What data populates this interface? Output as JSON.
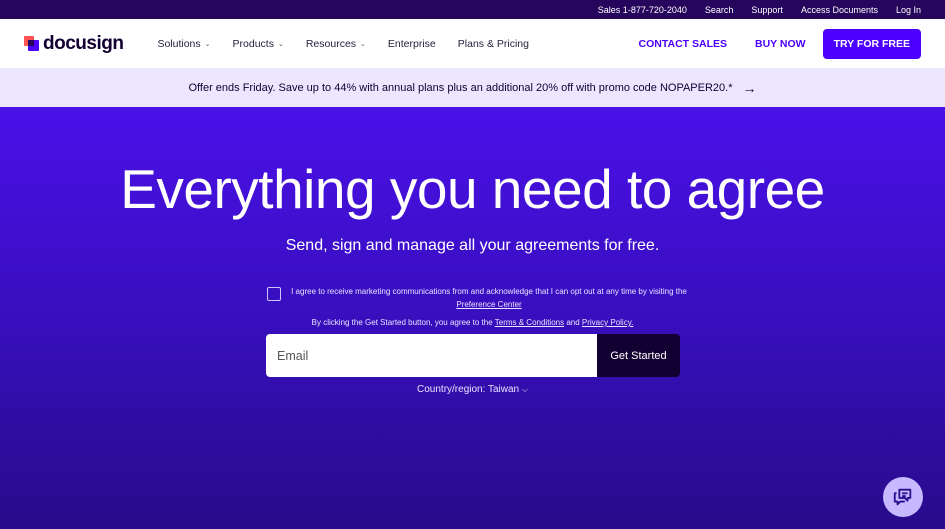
{
  "utility": {
    "sales": "Sales 1-877-720-2040",
    "search": "Search",
    "support": "Support",
    "access_documents": "Access Documents",
    "login": "Log In"
  },
  "nav": {
    "logo_text": "docusign",
    "links": [
      {
        "label": "Solutions",
        "dropdown": true
      },
      {
        "label": "Products",
        "dropdown": true
      },
      {
        "label": "Resources",
        "dropdown": true
      },
      {
        "label": "Enterprise",
        "dropdown": false
      },
      {
        "label": "Plans & Pricing",
        "dropdown": false
      }
    ],
    "contact_sales": "CONTACT SALES",
    "buy_now": "BUY NOW",
    "try_free": "TRY FOR FREE"
  },
  "promo": {
    "text": "Offer ends Friday. Save up to 44% with annual plans plus an additional 20% off with promo code NOPAPER20.*",
    "arrow": "→"
  },
  "hero": {
    "title": "Everything you need to agree",
    "subtitle": "Send, sign and manage all your agreements for free.",
    "consent_text": "I agree to receive marketing communications from and acknowledge that I can opt out at any time by visiting the ",
    "preference_center": "Preference Center",
    "terms_prefix": "By clicking the Get Started button, you agree to the ",
    "terms_link": "Terms & Conditions",
    "terms_and": " and ",
    "privacy_link": "Privacy Policy.",
    "email_placeholder": "Email",
    "get_started": "Get Started",
    "country_label": "Country/region: Taiwan"
  },
  "colors": {
    "brand": "#4c00ff",
    "utility_bg": "#26065d",
    "promo_bg": "#ece6ff",
    "button_dark": "#130032"
  },
  "icons": {
    "chevron": "chevron-down-icon",
    "promo_arrow": "arrow-right-icon",
    "chat": "chat-bubbles-icon"
  }
}
